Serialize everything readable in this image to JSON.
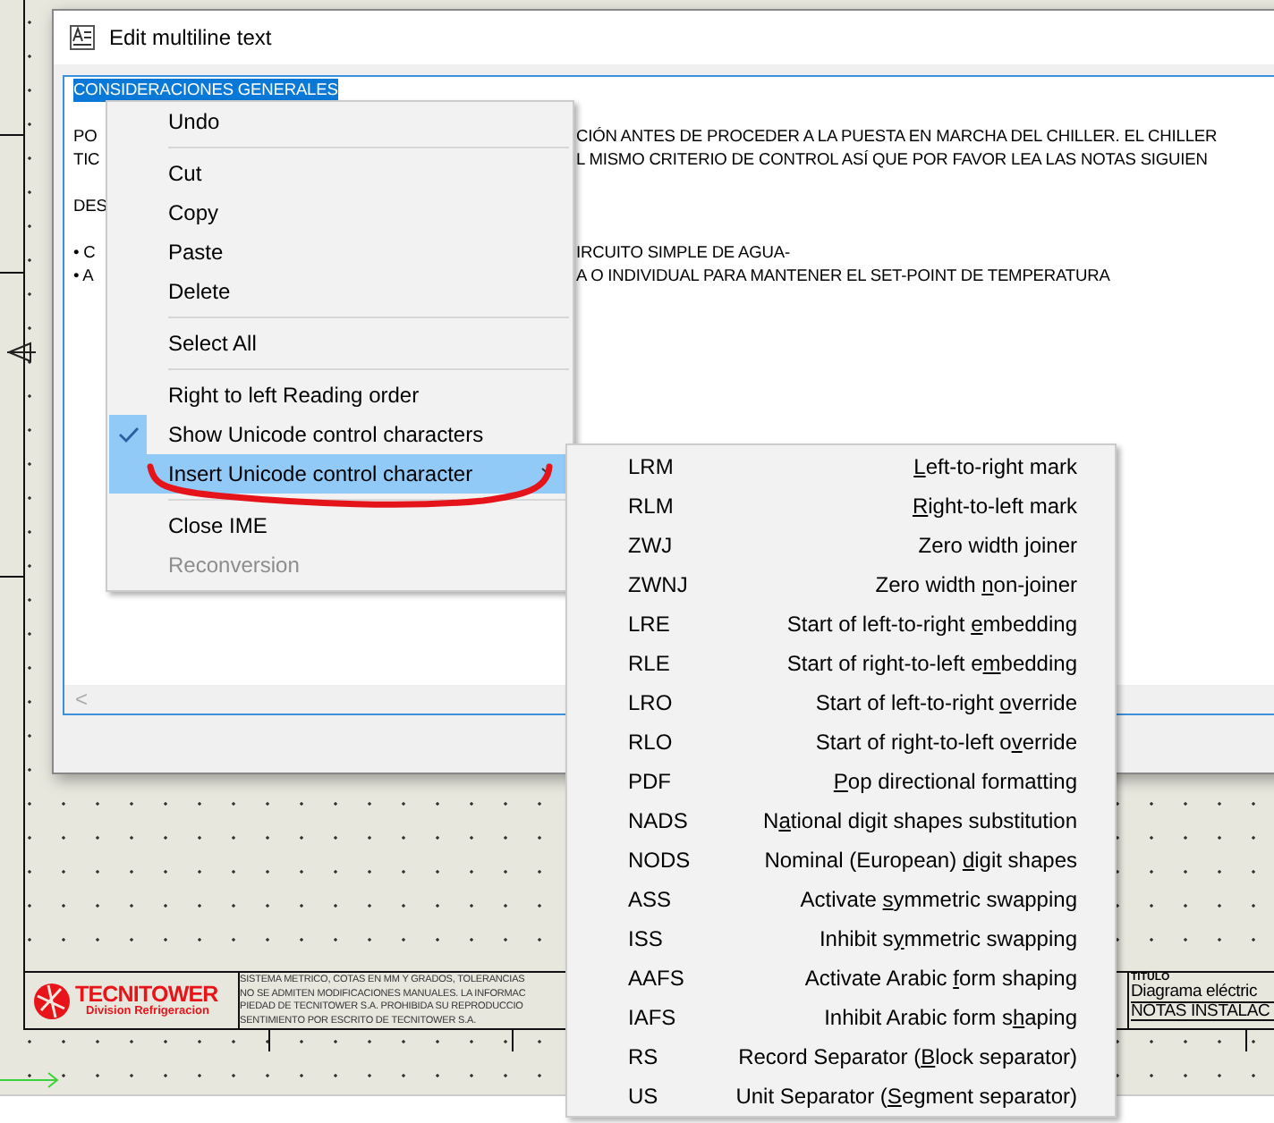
{
  "dialog": {
    "title": "Edit multiline text",
    "lines": [
      {
        "kind": "selected",
        "text": "CONSIDERACIONES GENERALES"
      },
      {
        "kind": "blank"
      },
      {
        "kind": "split",
        "left": "PO",
        "right": "CIÓN ANTES DE PROCEDER A LA PUESTA EN MARCHA DEL CHILLER. EL CHILLER"
      },
      {
        "kind": "split",
        "left": "TIC",
        "right": "L MISMO CRITERIO DE CONTROL ASÍ QUE POR FAVOR LEA LAS NOTAS SIGUIEN"
      },
      {
        "kind": "blank"
      },
      {
        "kind": "split",
        "left": "DES"
      },
      {
        "kind": "blank"
      },
      {
        "kind": "split",
        "left": "• C",
        "right": "IRCUITO SIMPLE DE AGUA-"
      },
      {
        "kind": "split",
        "left": "• A",
        "right": "A O INDIVIDUAL PARA MANTENER EL SET-POINT DE TEMPERATURA"
      }
    ],
    "scroll_arrow": "<"
  },
  "context_menu": {
    "items": [
      {
        "kind": "item",
        "label": "Undo",
        "checked": false,
        "selected": false,
        "disabled": false
      },
      {
        "kind": "separator"
      },
      {
        "kind": "item",
        "label": "Cut",
        "checked": false,
        "selected": false,
        "disabled": false
      },
      {
        "kind": "item",
        "label": "Copy",
        "checked": false,
        "selected": false,
        "disabled": false
      },
      {
        "kind": "item",
        "label": "Paste",
        "checked": false,
        "selected": false,
        "disabled": false
      },
      {
        "kind": "item",
        "label": "Delete",
        "checked": false,
        "selected": false,
        "disabled": false
      },
      {
        "kind": "separator"
      },
      {
        "kind": "item",
        "label": "Select All",
        "checked": false,
        "selected": false,
        "disabled": false
      },
      {
        "kind": "separator"
      },
      {
        "kind": "item",
        "label": "Right to left Reading order",
        "checked": false,
        "selected": false,
        "disabled": false
      },
      {
        "kind": "item",
        "label": "Show Unicode control characters",
        "checked": true,
        "selected": false,
        "disabled": false
      },
      {
        "kind": "submenu",
        "label": "Insert Unicode control character",
        "checked": false,
        "selected": true,
        "disabled": false
      },
      {
        "kind": "separator"
      },
      {
        "kind": "item",
        "label": "Close IME",
        "checked": false,
        "selected": false,
        "disabled": false
      },
      {
        "kind": "item",
        "label": "Reconversion",
        "checked": false,
        "selected": false,
        "disabled": true
      }
    ]
  },
  "submenu": {
    "items": [
      {
        "code": "LRM",
        "label": {
          "key": "L",
          "post": "eft-to-right mark"
        }
      },
      {
        "code": "RLM",
        "label": {
          "key": "R",
          "post": "ight-to-left mark"
        }
      },
      {
        "code": "ZWJ",
        "label": {
          "pre": "Zero width ",
          "key": "j",
          "post": "oiner"
        }
      },
      {
        "code": "ZWNJ",
        "label": {
          "pre": "Zero width ",
          "key": "n",
          "post": "on-joiner"
        }
      },
      {
        "code": "LRE",
        "label": {
          "pre": "Start of left-to-right ",
          "key": "e",
          "post": "mbedding"
        }
      },
      {
        "code": "RLE",
        "label": {
          "pre": "Start of right-to-left e",
          "key": "m",
          "post": "bedding"
        }
      },
      {
        "code": "LRO",
        "label": {
          "pre": "Start of left-to-right ",
          "key": "o",
          "post": "verride"
        }
      },
      {
        "code": "RLO",
        "label": {
          "pre": "Start of right-to-left o",
          "key": "v",
          "post": "erride"
        }
      },
      {
        "code": "PDF",
        "label": {
          "key": "P",
          "post": "op directional formatting"
        }
      },
      {
        "code": "NADS",
        "label": {
          "pre": "N",
          "key": "a",
          "post": "tional digit shapes substitution"
        }
      },
      {
        "code": "NODS",
        "label": {
          "pre": "Nominal (European) ",
          "key": "d",
          "post": "igit shapes"
        }
      },
      {
        "code": "ASS",
        "label": {
          "pre": "Activate ",
          "key": "s",
          "post": "ymmetric swapping"
        }
      },
      {
        "code": "ISS",
        "label": {
          "pre": "Inhibit s",
          "key": "y",
          "post": "mmetric swapping"
        }
      },
      {
        "code": "AAFS",
        "label": {
          "pre": "Activate Arabic ",
          "key": "f",
          "post": "orm shaping"
        }
      },
      {
        "code": "IAFS",
        "label": {
          "pre": "Inhibit Arabic form s",
          "key": "h",
          "post": "aping"
        }
      },
      {
        "code": "RS",
        "label": {
          "pre": "Record Separator (",
          "key": "B",
          "post": "lock separator)"
        }
      },
      {
        "code": "US",
        "label": {
          "pre": "Unit Separator (",
          "key": "S",
          "post": "egment separator)"
        }
      }
    ]
  },
  "title_block": {
    "logo": "TECNITOWER",
    "logo_subtitle": "Division Refrigeracion",
    "notes": [
      "SISTEMA METRICO, COTAS EN MM Y GRADOS, TOLERANCIAS",
      "NO SE ADMITEN MODIFICACIONES MANUALES. LA INFORMAC",
      "PIEDAD DE TECNITOWER S.A. PROHIBIDA SU REPRODUCCIO",
      "SENTIMIENTO POR ESCRITO DE TECNITOWER S.A."
    ],
    "title_label": "TITULO",
    "title_lines": [
      "Diagrama eléctric",
      "NOTAS INSTALAC"
    ]
  }
}
